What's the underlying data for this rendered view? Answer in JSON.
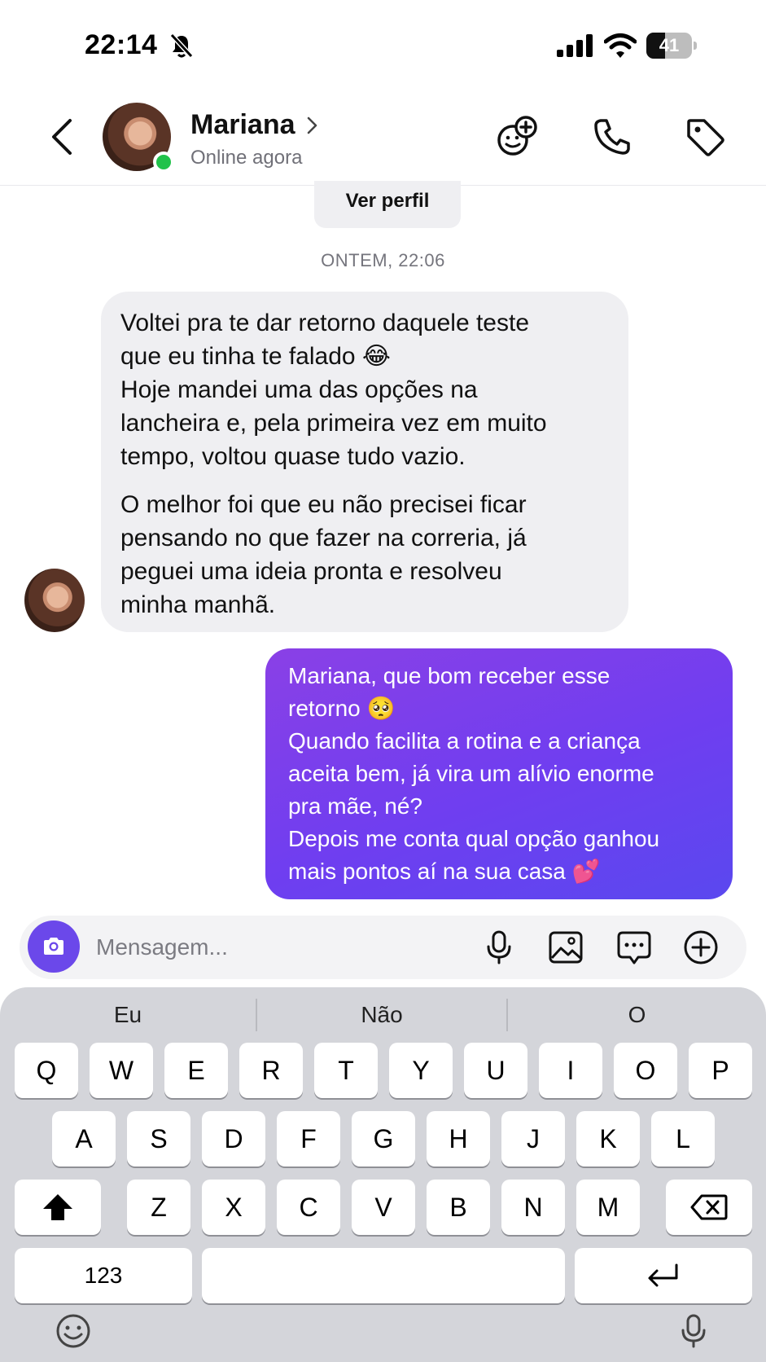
{
  "status_bar": {
    "time": "22:14",
    "battery": "41",
    "battery_level": 0.41
  },
  "header": {
    "contact_name": "Mariana",
    "contact_status": "Online agora",
    "icons": [
      "back-chevron-icon",
      "chevron-right-icon",
      "games-icon",
      "phone-icon",
      "tag-icon"
    ]
  },
  "chat": {
    "profile_button": "Ver perfil",
    "date_separator": "ONTEM, 22:06",
    "incoming": {
      "para1_l1": "Voltei pra te dar retorno daquele teste",
      "para1_l2": "que eu tinha te falado 😂",
      "para1_l3": "Hoje mandei uma das opções na",
      "para1_l4": "lancheira e, pela primeira vez em muito",
      "para1_l5": "tempo, voltou quase tudo vazio.",
      "para2_l1": "O melhor foi que eu não precisei ficar",
      "para2_l2": "pensando no que fazer na correria, já",
      "para2_l3": "peguei uma ideia pronta e resolveu",
      "para2_l4": "minha manhã."
    },
    "outgoing": {
      "l1": "Mariana, que bom receber esse",
      "l2": "retorno 🥺",
      "l3": "Quando facilita a rotina e a criança",
      "l4": "aceita bem, já vira um alívio enorme",
      "l5": "pra mãe, né?",
      "l6": "Depois me conta qual opção ganhou",
      "l7": "mais pontos aí na sua casa 💕"
    },
    "colors": {
      "outgoing_start": "#8a40e6",
      "outgoing_end": "#5a48ef",
      "online": "#21c24a"
    }
  },
  "composer": {
    "placeholder": "Mensagem...",
    "icons": [
      "camera-icon",
      "microphone-icon",
      "gallery-icon",
      "sticker-icon",
      "plus-icon"
    ]
  },
  "keyboard": {
    "suggestions": [
      "Eu",
      "Não",
      "O"
    ],
    "row1": [
      "Q",
      "W",
      "E",
      "R",
      "T",
      "Y",
      "U",
      "I",
      "O",
      "P"
    ],
    "row2": [
      "A",
      "S",
      "D",
      "F",
      "G",
      "H",
      "J",
      "K",
      "L"
    ],
    "row3": [
      "Z",
      "X",
      "C",
      "V",
      "B",
      "N",
      "M"
    ],
    "numbers_key": "123",
    "icons": [
      "shift-icon",
      "backspace-icon",
      "return-icon",
      "emoji-icon",
      "dictation-icon"
    ]
  }
}
